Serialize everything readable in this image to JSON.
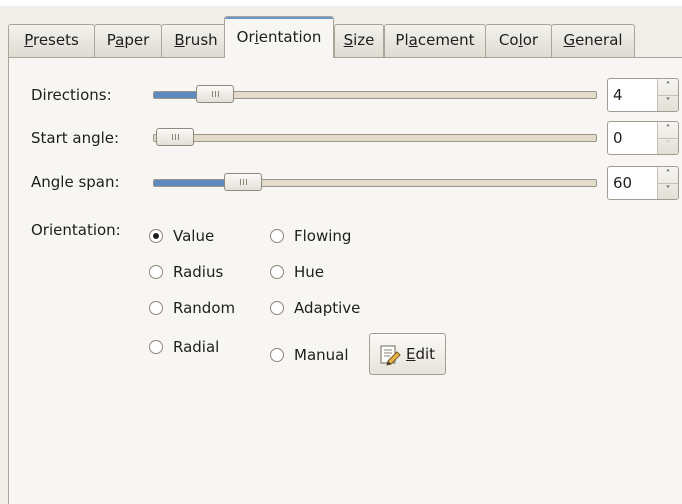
{
  "tabs": [
    {
      "label": "Presets",
      "mnemonic": 0
    },
    {
      "label": "Paper",
      "mnemonic": 1
    },
    {
      "label": "Brush",
      "mnemonic": 0
    },
    {
      "label": "Orientation",
      "mnemonic": 2
    },
    {
      "label": "Size",
      "mnemonic": 0
    },
    {
      "label": "Placement",
      "mnemonic": 2
    },
    {
      "label": "Color",
      "mnemonic": 2
    },
    {
      "label": "General",
      "mnemonic": 0
    }
  ],
  "active_tab": "Orientation",
  "sliders": {
    "directions": {
      "label": "Directions:",
      "value": "4",
      "level": 0.1,
      "down_disabled": false
    },
    "start_angle": {
      "label": "Start angle:",
      "value": "0",
      "level": 0.0,
      "down_disabled": true
    },
    "angle_span": {
      "label": "Angle span:",
      "value": "60",
      "level": 0.17,
      "down_disabled": false
    }
  },
  "orientation": {
    "label": "Orientation:",
    "selected": "Value",
    "options_left": [
      "Value",
      "Radius",
      "Random",
      "Radial"
    ],
    "options_right": [
      "Flowing",
      "Hue",
      "Adaptive",
      "Manual"
    ]
  },
  "edit_button": {
    "label": "Edit",
    "icon": "edit-document-icon"
  },
  "colors": {
    "slider_fill": "#5c8ac0",
    "trough": "#e3dccb",
    "active_tab_accent": "#6d96c8"
  }
}
